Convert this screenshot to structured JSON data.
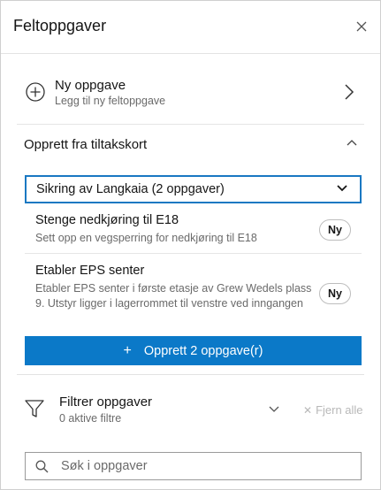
{
  "header": {
    "title": "Feltoppgaver"
  },
  "new_task": {
    "title": "Ny oppgave",
    "subtitle": "Legg til ny feltoppgave"
  },
  "section": {
    "title": "Opprett fra tiltakskort"
  },
  "dropdown": {
    "selected": "Sikring av Langkaia (2 oppgaver)"
  },
  "tasks": [
    {
      "title": "Stenge nedkjøring til E18",
      "description": "Sett opp en vegsperring for nedkjøring til E18",
      "badge": "Ny"
    },
    {
      "title": "Etabler EPS senter",
      "description": "Etabler EPS senter i første etasje av Grew Wedels plass 9. Utstyr ligger i lagerrommet til venstre ved inngangen",
      "badge": "Ny"
    }
  ],
  "create_button": {
    "label": "Opprett 2 oppgave(r)"
  },
  "filter": {
    "title": "Filtrer oppgaver",
    "subtitle": "0 aktive filtre",
    "clear_label": "Fjern alle"
  },
  "search": {
    "placeholder": "Søk i oppgaver"
  },
  "colors": {
    "accent": "#0b79c8",
    "focus_border": "#1a78c2"
  },
  "icons": [
    "close-icon",
    "plus-circle-icon",
    "chevron-right-icon",
    "chevron-up-icon",
    "chevron-down-icon",
    "plus-icon",
    "filter-icon",
    "x-icon",
    "search-icon"
  ]
}
